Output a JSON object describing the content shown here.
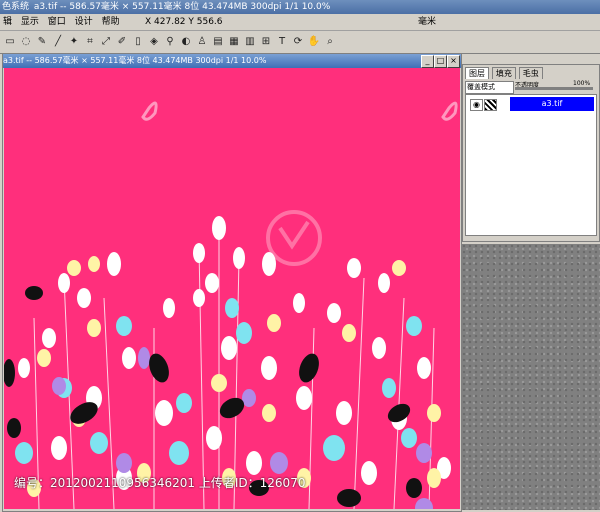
{
  "app": {
    "title": "色系统",
    "title_file_info": "a3.tif -- 586.57毫米 × 557.11毫米 8位 43.474MB 300dpi 1/1 10.0%"
  },
  "menubar": {
    "items": [
      "辑",
      "显示",
      "窗口",
      "设计",
      "帮助"
    ],
    "coords": "X  427.82  Y  556.6",
    "unit": "毫米"
  },
  "document": {
    "title": "a3.tif -- 586.57毫米 × 557.11毫米 8位 43.474MB 300dpi 1/1 10.0%",
    "canvas_color": "#ff2f7c"
  },
  "panel": {
    "tabs": [
      "图层",
      "填充",
      "毛虫"
    ],
    "blend_mode": "覆盖模式",
    "opacity_label": "不透明度",
    "opacity_value": "100%",
    "layer_name": "a3.tif"
  },
  "watermark": {
    "info": "编号：20120021109563462​01  上传者ID：126070"
  },
  "icons": {
    "tools": [
      "select-rect-icon",
      "lasso-icon",
      "pen-icon",
      "line-icon",
      "magic-wand-icon",
      "crop-icon",
      "transform-icon",
      "brush-icon",
      "eraser-icon",
      "fill-icon",
      "dropper-icon",
      "gradient-icon",
      "stamp-icon",
      "layer-icon",
      "grid-icon",
      "text-icon",
      "hand-icon",
      "zoom-icon"
    ]
  }
}
